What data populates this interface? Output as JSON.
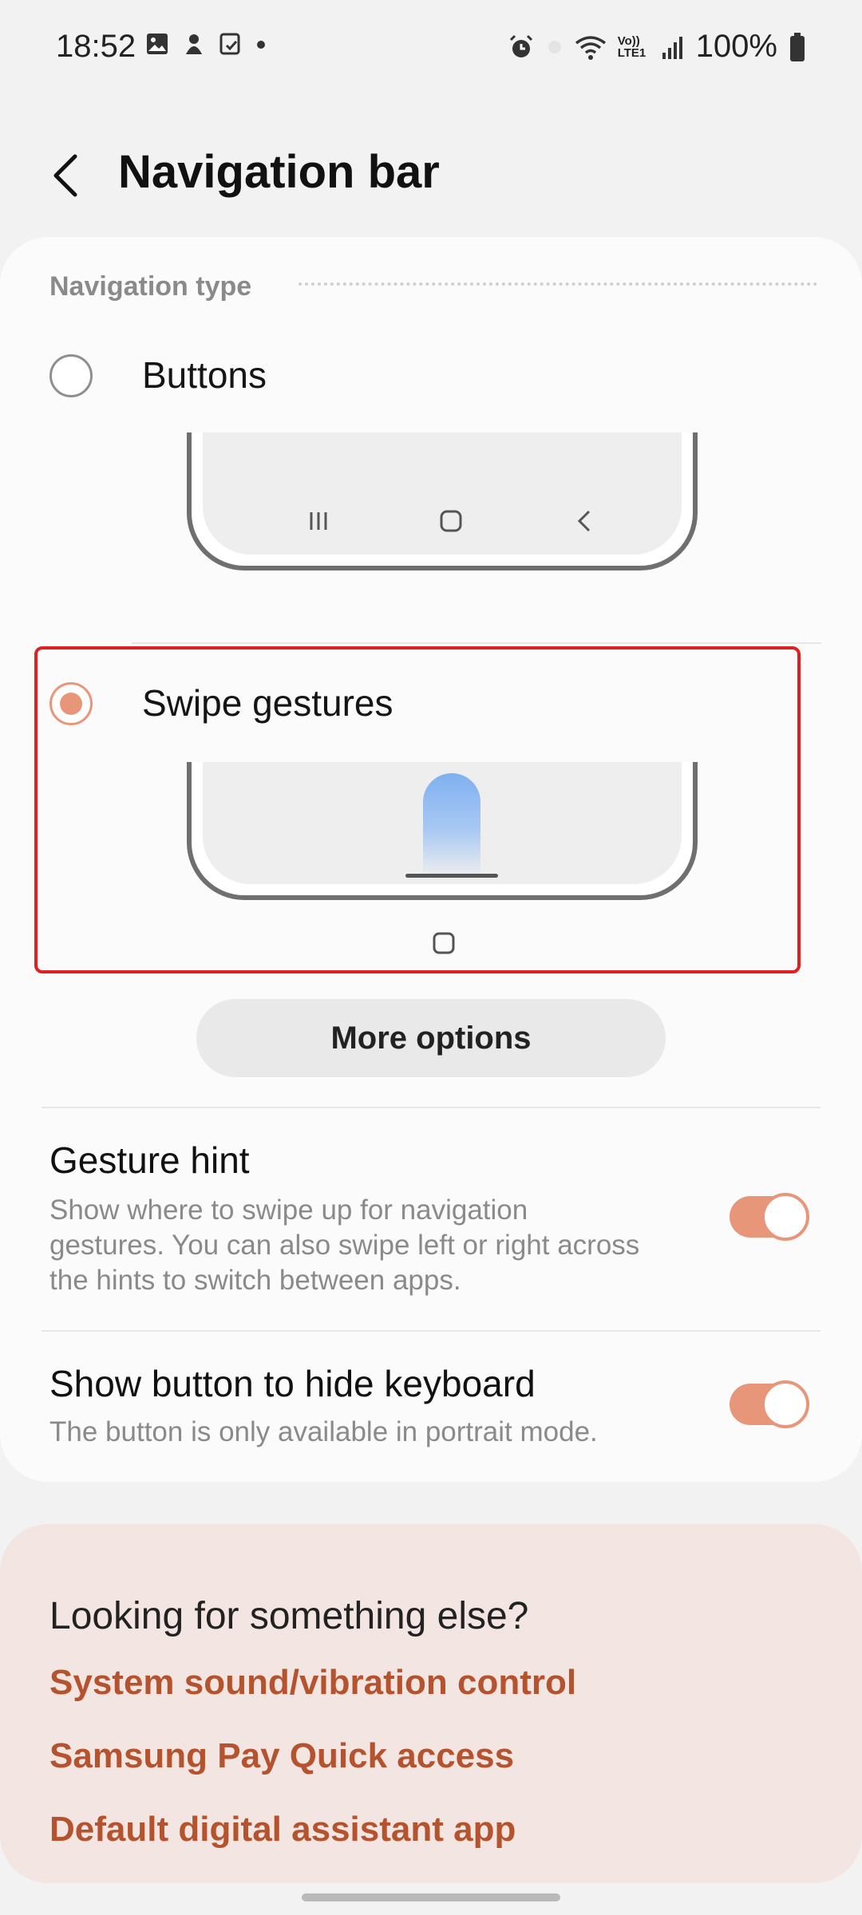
{
  "status_bar": {
    "time": "18:52",
    "battery": "100%",
    "network_label": "Vo)) LTE1"
  },
  "header": {
    "title": "Navigation bar",
    "back_icon": "chevron-left-icon"
  },
  "navigation_type": {
    "section_label": "Navigation type",
    "options": [
      {
        "label": "Buttons",
        "selected": false
      },
      {
        "label": "Swipe gestures",
        "selected": true
      }
    ]
  },
  "more_options_label": "More options",
  "settings": {
    "gesture_hint": {
      "title": "Gesture hint",
      "description": "Show where to swipe up for navigation gestures. You can also swipe left or right across the hints to switch between apps.",
      "enabled": true
    },
    "hide_keyboard": {
      "title": "Show button to hide keyboard",
      "description": "The button is only available in portrait mode.",
      "enabled": true
    }
  },
  "suggestions": {
    "title": "Looking for something else?",
    "links": [
      "System sound/vibration control",
      "Samsung Pay Quick access",
      "Default digital assistant app"
    ]
  },
  "colors": {
    "accent": "#e8967a",
    "link": "#b5532f",
    "highlight_border": "#e02020",
    "gesture_blue": "#7fb0f0"
  }
}
